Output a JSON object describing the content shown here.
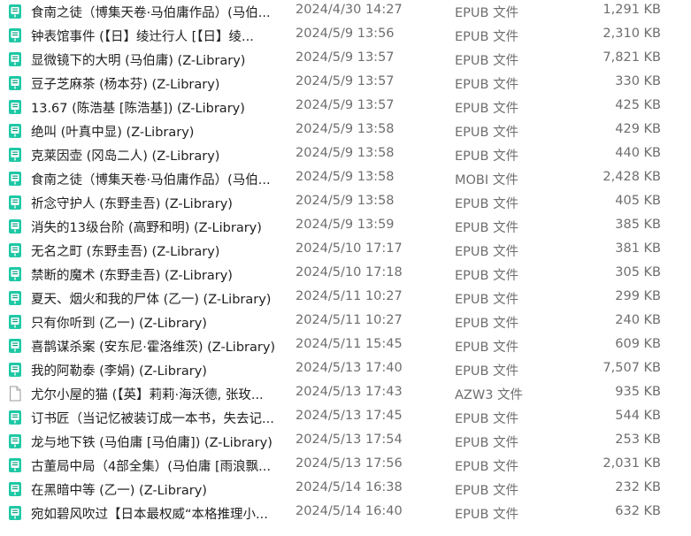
{
  "files": [
    {
      "name": "食南之徒（博集天卷·马伯庸作品）(马伯...",
      "date": "2024/4/30 14:27",
      "type": "EPUB 文件",
      "size": "1,291 KB",
      "icon": "ebook-app-icon"
    },
    {
      "name": "钟表馆事件 (【日】绫辻行人 [【日】绫...",
      "date": "2024/5/9 13:56",
      "type": "EPUB 文件",
      "size": "2,310 KB",
      "icon": "ebook-app-icon"
    },
    {
      "name": "显微镜下的大明 (马伯庸) (Z-Library)",
      "date": "2024/5/9 13:57",
      "type": "EPUB 文件",
      "size": "7,821 KB",
      "icon": "ebook-app-icon"
    },
    {
      "name": "豆子芝麻茶 (杨本芬) (Z-Library)",
      "date": "2024/5/9 13:57",
      "type": "EPUB 文件",
      "size": "330 KB",
      "icon": "ebook-app-icon"
    },
    {
      "name": "13.67 (陈浩基 [陈浩基]) (Z-Library)",
      "date": "2024/5/9 13:57",
      "type": "EPUB 文件",
      "size": "425 KB",
      "icon": "ebook-app-icon"
    },
    {
      "name": "绝叫 (叶真中显) (Z-Library)",
      "date": "2024/5/9 13:58",
      "type": "EPUB 文件",
      "size": "429 KB",
      "icon": "ebook-app-icon"
    },
    {
      "name": "克莱因壶 (冈岛二人) (Z-Library)",
      "date": "2024/5/9 13:58",
      "type": "EPUB 文件",
      "size": "440 KB",
      "icon": "ebook-app-icon"
    },
    {
      "name": "食南之徒（博集天卷·马伯庸作品）(马伯...",
      "date": "2024/5/9 13:58",
      "type": "MOBI 文件",
      "size": "2,428 KB",
      "icon": "ebook-app-icon"
    },
    {
      "name": "祈念守护人 (东野圭吾) (Z-Library)",
      "date": "2024/5/9 13:58",
      "type": "EPUB 文件",
      "size": "405 KB",
      "icon": "ebook-app-icon"
    },
    {
      "name": "消失的13级台阶 (高野和明) (Z-Library)",
      "date": "2024/5/9 13:59",
      "type": "EPUB 文件",
      "size": "385 KB",
      "icon": "ebook-app-icon"
    },
    {
      "name": "无名之町 (东野圭吾) (Z-Library)",
      "date": "2024/5/10 17:17",
      "type": "EPUB 文件",
      "size": "381 KB",
      "icon": "ebook-app-icon"
    },
    {
      "name": "禁断的魔术 (东野圭吾) (Z-Library)",
      "date": "2024/5/10 17:18",
      "type": "EPUB 文件",
      "size": "305 KB",
      "icon": "ebook-app-icon"
    },
    {
      "name": "夏天、烟火和我的尸体 (乙一) (Z-Library)",
      "date": "2024/5/11 10:27",
      "type": "EPUB 文件",
      "size": "299 KB",
      "icon": "ebook-app-icon"
    },
    {
      "name": "只有你听到 (乙一) (Z-Library)",
      "date": "2024/5/11 10:27",
      "type": "EPUB 文件",
      "size": "240 KB",
      "icon": "ebook-app-icon"
    },
    {
      "name": "喜鹊谋杀案 (安东尼·霍洛维茨) (Z-Library)",
      "date": "2024/5/11 15:45",
      "type": "EPUB 文件",
      "size": "609 KB",
      "icon": "ebook-app-icon"
    },
    {
      "name": "我的阿勒泰 (李娟) (Z-Library)",
      "date": "2024/5/13 17:40",
      "type": "EPUB 文件",
      "size": "7,507 KB",
      "icon": "ebook-app-icon"
    },
    {
      "name": "尤尔小屋的猫 (【英】莉莉·海沃德, 张玫...",
      "date": "2024/5/13 17:43",
      "type": "AZW3 文件",
      "size": "935 KB",
      "icon": "blank-file-icon"
    },
    {
      "name": "订书匠（当记忆被装订成一本书，失去记...",
      "date": "2024/5/13 17:45",
      "type": "EPUB 文件",
      "size": "544 KB",
      "icon": "ebook-app-icon"
    },
    {
      "name": "龙与地下铁 (马伯庸 [马伯庸]) (Z-Library)",
      "date": "2024/5/13 17:54",
      "type": "EPUB 文件",
      "size": "253 KB",
      "icon": "ebook-app-icon"
    },
    {
      "name": "古董局中局（4部全集）(马伯庸 [雨浪飘...",
      "date": "2024/5/13 17:56",
      "type": "EPUB 文件",
      "size": "2,031 KB",
      "icon": "ebook-app-icon"
    },
    {
      "name": "在黑暗中等 (乙一) (Z-Library)",
      "date": "2024/5/14 16:38",
      "type": "EPUB 文件",
      "size": "232 KB",
      "icon": "ebook-app-icon"
    },
    {
      "name": "宛如碧风吹过【日本最权威“本格推理小...",
      "date": "2024/5/14 16:40",
      "type": "EPUB 文件",
      "size": "632 KB",
      "icon": "ebook-app-icon"
    }
  ],
  "colors": {
    "ebook_icon": "#1ec8a5",
    "ebook_icon_dark": "#0e9c82",
    "text_primary": "#1f1f1f",
    "text_secondary": "#6e6e6e"
  }
}
